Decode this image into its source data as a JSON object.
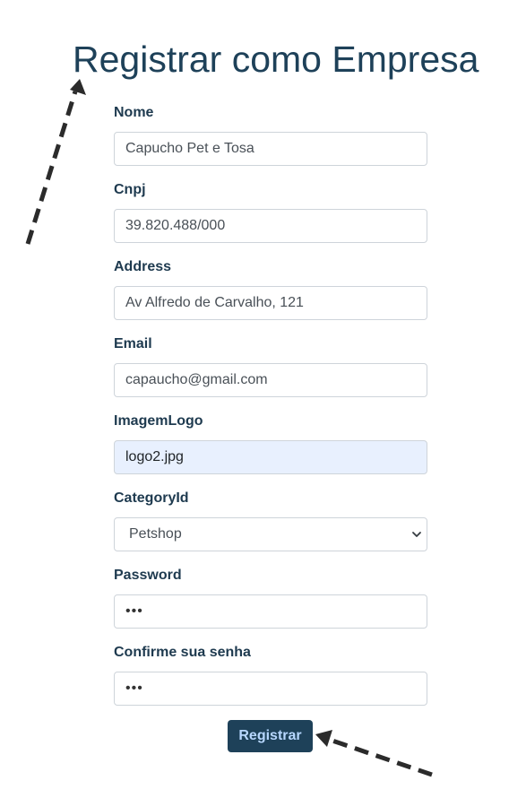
{
  "page": {
    "title": "Registrar como Empresa"
  },
  "form": {
    "nome": {
      "label": "Nome",
      "value": "Capucho Pet e Tosa"
    },
    "cnpj": {
      "label": "Cnpj",
      "value": "39.820.488/000"
    },
    "address": {
      "label": "Address",
      "value": "Av Alfredo de Carvalho, 121"
    },
    "email": {
      "label": "Email",
      "value": "capaucho@gmail.com"
    },
    "imagem_logo": {
      "label": "ImagemLogo",
      "value": "logo2.jpg"
    },
    "category": {
      "label": "CategoryId",
      "selected": "Petshop"
    },
    "password": {
      "label": "Password",
      "value": "•••"
    },
    "confirm_password": {
      "label": "Confirme sua senha",
      "value": "•••"
    },
    "submit_label": "Registrar"
  },
  "colors": {
    "title": "#1e4159",
    "button_bg": "#1e4159",
    "button_text": "#b7d7ff",
    "autofill_bg": "#e8f0fe",
    "annotation_arrow": "#2b2b2b"
  },
  "icons": {
    "select_chevron": "chevron-down-icon",
    "annotation": "dashed-arrow-icon"
  }
}
